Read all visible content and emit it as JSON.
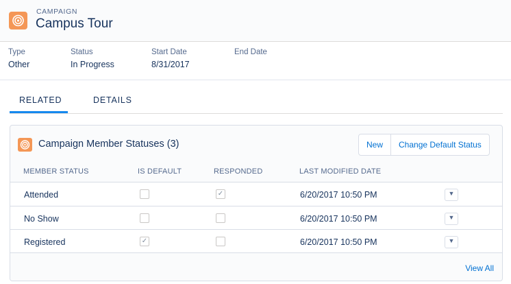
{
  "header": {
    "eyebrow": "CAMPAIGN",
    "title": "Campus Tour",
    "icon": "campaign-target-icon",
    "icon_color": "#f49756"
  },
  "fields": [
    {
      "label": "Type",
      "value": "Other"
    },
    {
      "label": "Status",
      "value": "In Progress"
    },
    {
      "label": "Start Date",
      "value": "8/31/2017"
    },
    {
      "label": "End Date",
      "value": ""
    }
  ],
  "tabs": [
    {
      "label": "RELATED",
      "active": true
    },
    {
      "label": "DETAILS",
      "active": false
    }
  ],
  "related_card": {
    "title": "Campaign Member Statuses (3)",
    "buttons": {
      "new": "New",
      "change_default": "Change Default Status"
    },
    "columns": [
      "MEMBER STATUS",
      "IS DEFAULT",
      "RESPONDED",
      "LAST MODIFIED DATE"
    ],
    "rows": [
      {
        "member_status": "Attended",
        "is_default": false,
        "responded": true,
        "last_modified": "6/20/2017 10:50 PM"
      },
      {
        "member_status": "No Show",
        "is_default": false,
        "responded": false,
        "last_modified": "6/20/2017 10:50 PM"
      },
      {
        "member_status": "Registered",
        "is_default": true,
        "responded": false,
        "last_modified": "6/20/2017 10:50 PM"
      }
    ],
    "view_all": "View All"
  },
  "colors": {
    "accent": "#0070d2",
    "tab_active": "#1589ee",
    "text": "#16325c",
    "label": "#54698d"
  }
}
